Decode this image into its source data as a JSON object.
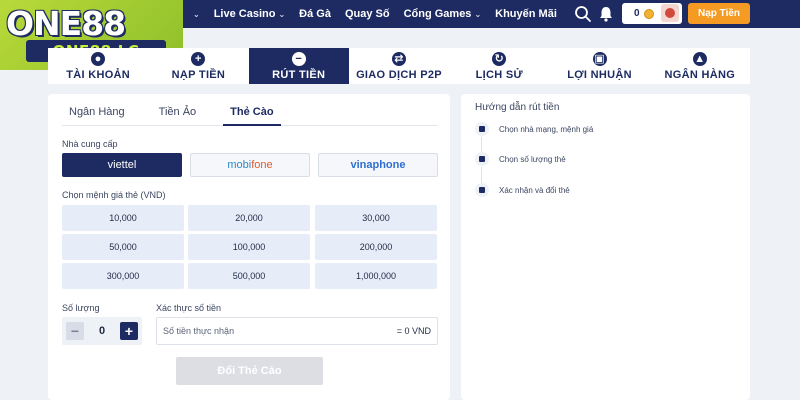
{
  "brand": {
    "logo_text": "ONE88",
    "logo_subtext": "ONE88.LC",
    "colors": {
      "primary": "#1d2b62",
      "accent": "#f59a23",
      "logo_green": "#b8d93a"
    }
  },
  "header": {
    "nav": [
      {
        "label": "",
        "has_dropdown": true
      },
      {
        "label": "Live Casino",
        "has_dropdown": true
      },
      {
        "label": "Đá Gà",
        "has_dropdown": false
      },
      {
        "label": "Quay Số",
        "has_dropdown": false
      },
      {
        "label": "Cổng Games",
        "has_dropdown": true
      },
      {
        "label": "Khuyến Mãi",
        "has_dropdown": false
      }
    ],
    "balance": "0",
    "deposit_button": "Nạp Tiền",
    "icons": [
      "search-icon",
      "bell-icon",
      "coin-icon",
      "avatar"
    ]
  },
  "tabs": [
    {
      "label": "TÀI KHOẢN",
      "icon": "user-icon"
    },
    {
      "label": "NẠP TIỀN",
      "icon": "plus-icon"
    },
    {
      "label": "RÚT TIỀN",
      "icon": "minus-icon",
      "active": true
    },
    {
      "label": "GIAO DỊCH P2P",
      "icon": "swap-icon"
    },
    {
      "label": "LỊCH SỬ",
      "icon": "history-icon"
    },
    {
      "label": "LỢI NHUẬN",
      "icon": "gift-icon"
    },
    {
      "label": "NGÂN HÀNG",
      "icon": "bank-icon"
    }
  ],
  "withdraw": {
    "subtabs": [
      {
        "label": "Ngân Hàng"
      },
      {
        "label": "Tiền Ảo"
      },
      {
        "label": "Thẻ Cào",
        "active": true
      }
    ],
    "provider_label": "Nhà cung cấp",
    "providers": [
      {
        "name": "viettel",
        "active": true
      },
      {
        "name_a": "mobi",
        "name_b": "fone"
      },
      {
        "name": "vinaphone"
      }
    ],
    "denomination_label": "Chọn mệnh giá thẻ (VND)",
    "denominations": [
      "10,000",
      "20,000",
      "30,000",
      "50,000",
      "100,000",
      "200,000",
      "300,000",
      "500,000",
      "1,000,000"
    ],
    "quantity_label": "Số lượng",
    "quantity": "0",
    "verify_label": "Xác thực số tiền",
    "amount_placeholder": "Số tiền thực nhận",
    "amount_total": "= 0 VND",
    "submit_label": "Đổi Thẻ Cào"
  },
  "guide": {
    "title": "Hướng dẫn rút tiền",
    "steps": [
      {
        "text": "Chọn nhà mạng, mệnh giá",
        "icon": "check-icon"
      },
      {
        "text": "Chọn số lượng thẻ",
        "icon": "card-icon"
      },
      {
        "text": "Xác nhận và đổi thẻ",
        "icon": "phone-icon"
      }
    ]
  }
}
